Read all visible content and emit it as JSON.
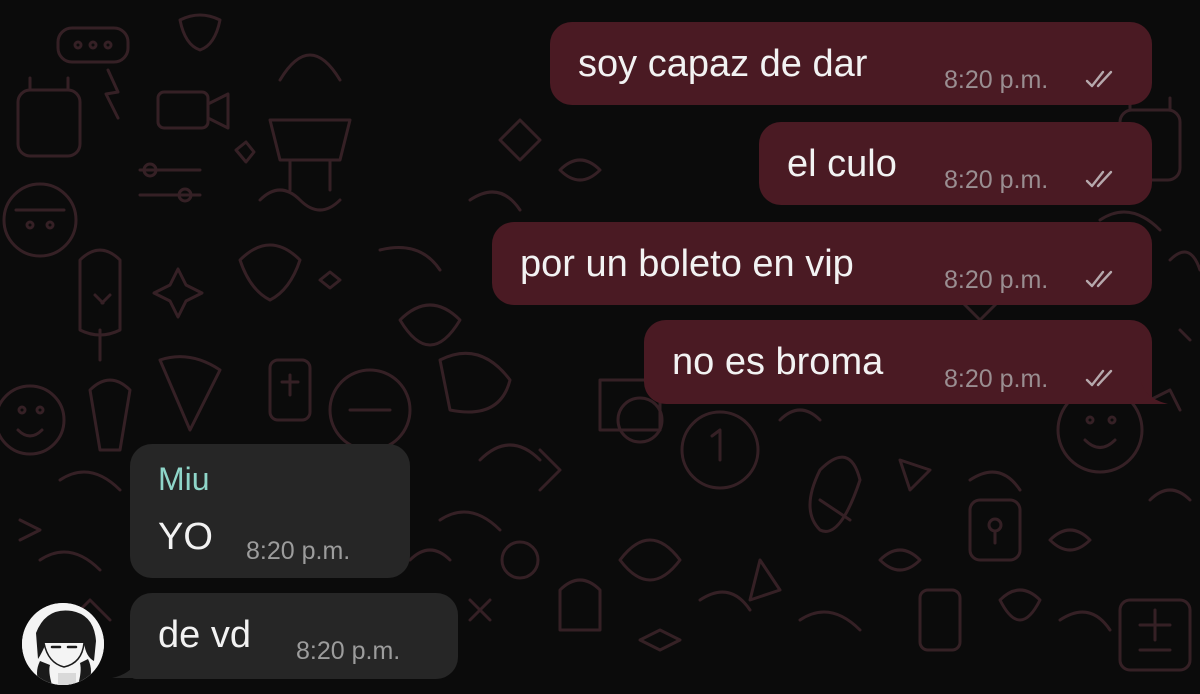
{
  "colors": {
    "outgoing_bubble": "#4a1a23",
    "incoming_bubble": "#262626",
    "sender_name": "#8fd6c9",
    "background": "#0b0b0b"
  },
  "messages": {
    "outgoing": [
      {
        "text": "soy capaz de dar",
        "time": "8:20 p.m.",
        "status": "read-ticks-icon"
      },
      {
        "text": "el culo",
        "time": "8:20 p.m.",
        "status": "read-ticks-icon"
      },
      {
        "text": "por un boleto en vip",
        "time": "8:20 p.m.",
        "status": "read-ticks-icon"
      },
      {
        "text": "no es broma",
        "time": "8:20 p.m.",
        "status": "read-ticks-icon"
      }
    ],
    "incoming": [
      {
        "sender": "Miu",
        "text": "YO",
        "time": "8:20 p.m."
      },
      {
        "text": "de vd",
        "time": "8:20 p.m."
      }
    ]
  },
  "contact": {
    "avatar": "anime-avatar"
  }
}
